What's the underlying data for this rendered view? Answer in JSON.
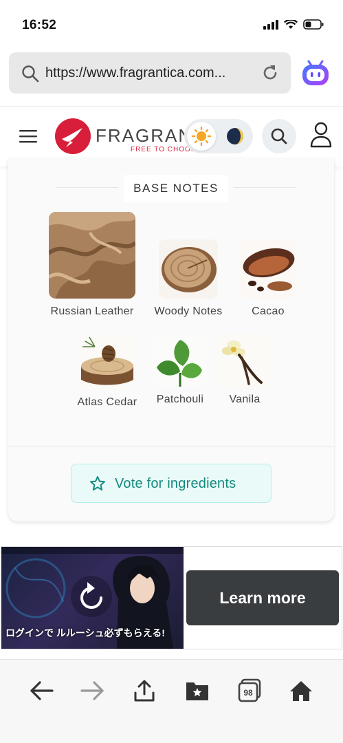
{
  "status": {
    "time": "16:52"
  },
  "browser": {
    "url": "https://www.fragrantica.com..."
  },
  "header": {
    "brand": "FRAGRANTICA",
    "tagline": "FREE TO CHOOSE"
  },
  "section": {
    "title": "BASE NOTES",
    "notes": [
      {
        "name": "Russian Leather",
        "icon": "leather-image"
      },
      {
        "name": "Woody Notes",
        "icon": "wood-slice-image"
      },
      {
        "name": "Cacao",
        "icon": "cacao-image"
      },
      {
        "name": "Atlas Cedar",
        "icon": "cedar-image"
      },
      {
        "name": "Patchouli",
        "icon": "patchouli-leaf-image"
      },
      {
        "name": "Vanila",
        "icon": "vanilla-flower-image"
      }
    ],
    "vote_label": "Vote for ingredients"
  },
  "ad": {
    "banner_text": "ログインで ルルーシュ必ずもらえる!",
    "cta": "Learn more"
  },
  "toolbar": {
    "tabs_count": "98"
  },
  "colors": {
    "brand": "#d81e3a",
    "vote_text": "#138a80",
    "vote_bg": "#eafaf8",
    "ad_button": "#3a3d40"
  }
}
